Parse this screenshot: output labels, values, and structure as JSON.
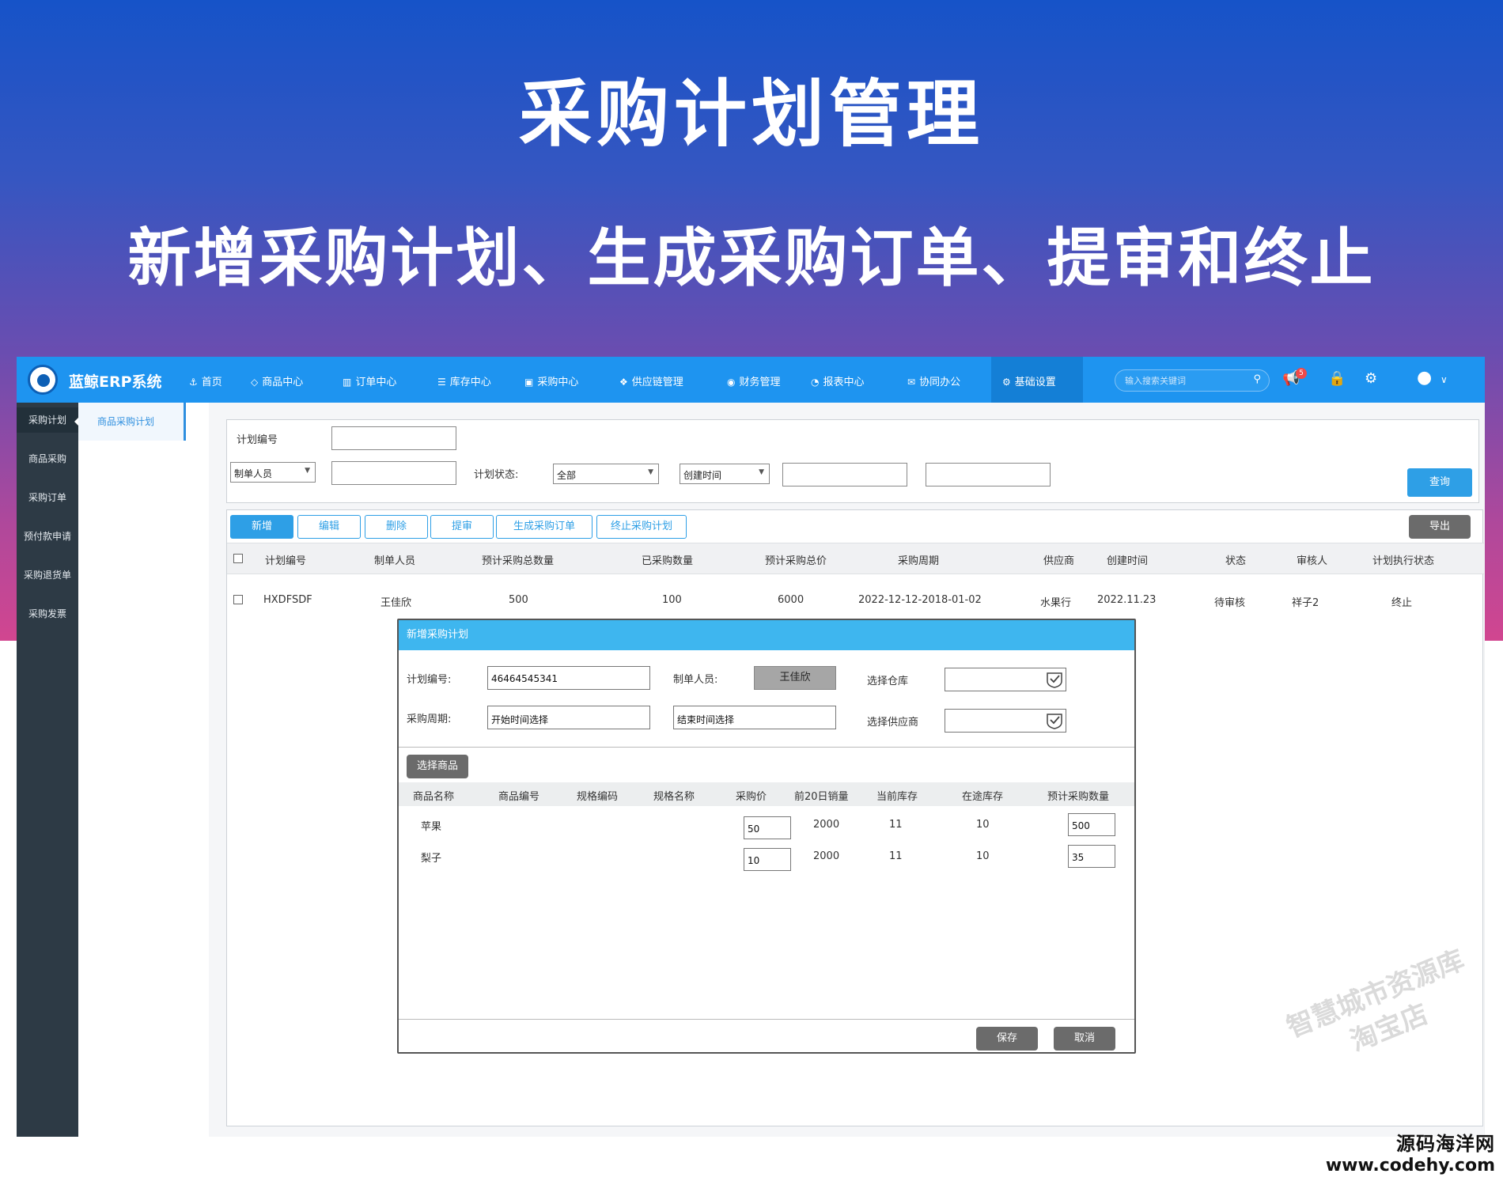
{
  "slide": {
    "title": "采购计划管理",
    "subtitle": "新增采购计划、生成采购订单、提审和终止"
  },
  "app": {
    "brand": "蓝鲸ERP系统",
    "nav": [
      "首页",
      "商品中心",
      "订单中心",
      "库存中心",
      "采购中心",
      "供应链管理",
      "财务管理",
      "报表中心",
      "协同办公",
      "基础设置"
    ],
    "nav_active": "基础设置",
    "search_placeholder": "输入搜索关键词",
    "notification_count": "5",
    "colors": {
      "topbar": "#1e94f0",
      "sidebar": "#2d3a45",
      "accent": "#2e9fe6",
      "modal_header": "#3eb6ef"
    }
  },
  "sidebar": {
    "items": [
      "采购计划",
      "商品采购",
      "采购订单",
      "预付款申请",
      "采购退货单",
      "采购发票"
    ],
    "active": "采购计划"
  },
  "subnav": {
    "items": [
      "商品采购计划"
    ]
  },
  "filters": {
    "plan_no_label": "计划编号",
    "maker_select": "制单人员",
    "status_label": "计划状态:",
    "status_value": "全部",
    "time_select": "创建时间",
    "query_button": "查询"
  },
  "toolbar": {
    "buttons": [
      "新增",
      "编辑",
      "删除",
      "提审",
      "生成采购订单",
      "终止采购计划"
    ],
    "export_button": "导出"
  },
  "table": {
    "columns": [
      "计划编号",
      "制单人员",
      "预计采购总数量",
      "已采购数量",
      "预计采购总价",
      "采购周期",
      "供应商",
      "创建时间",
      "状态",
      "审核人",
      "计划执行状态"
    ],
    "rows": [
      [
        "HXDFSDF",
        "王佳欣",
        "500",
        "100",
        "6000",
        "2022-12-12-2018-01-02",
        "水果行",
        "2022.11.23",
        "待审核",
        "祥子2",
        "终止"
      ]
    ]
  },
  "modal": {
    "title": "新增采购计划",
    "plan_no_label": "计划编号:",
    "plan_no_value": "46464545341",
    "maker_label": "制单人员:",
    "maker_value": "王佳欣",
    "warehouse_label": "选择仓库",
    "period_label": "采购周期:",
    "start_placeholder": "开始时间选择",
    "end_placeholder": "结束时间选择",
    "supplier_label": "选择供应商",
    "select_goods_button": "选择商品",
    "product_columns": [
      "商品名称",
      "商品编号",
      "规格编码",
      "规格名称",
      "采购价",
      "前20日销量",
      "当前库存",
      "在途库存",
      "预计采购数量"
    ],
    "products": [
      {
        "name": "苹果",
        "price": "50",
        "sales20": "2000",
        "stock": "11",
        "transit": "10",
        "qty": "500"
      },
      {
        "name": "梨子",
        "price": "10",
        "sales20": "2000",
        "stock": "11",
        "transit": "10",
        "qty": "35"
      }
    ],
    "save_button": "保存",
    "cancel_button": "取消"
  },
  "watermark": {
    "line1": "智慧城市资源库",
    "line2": "淘宝店"
  },
  "footer": {
    "brand": "源码海洋网",
    "url": "www.codehy.com"
  }
}
